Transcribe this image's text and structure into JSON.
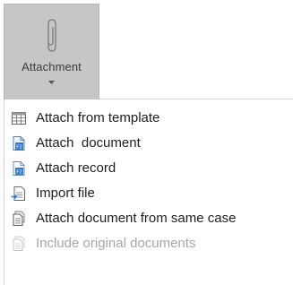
{
  "ribbon": {
    "attachment_button": {
      "label": "Attachment",
      "icon": "paperclip-icon",
      "state": "pressed"
    }
  },
  "menu": {
    "items": [
      {
        "label": "Attach from template",
        "icon": "template-grid-icon",
        "enabled": true
      },
      {
        "label": "Attach  document",
        "icon": "f2-document-icon",
        "enabled": true
      },
      {
        "label": "Attach record",
        "icon": "f2-record-icon",
        "enabled": true
      },
      {
        "label": "Import file",
        "icon": "import-file-icon",
        "enabled": true
      },
      {
        "label": "Attach document from same case",
        "icon": "case-document-icon",
        "enabled": true
      },
      {
        "label": "Include original documents",
        "icon": "original-documents-icon",
        "enabled": false
      }
    ]
  },
  "colors": {
    "button_pressed_bg": "#c6c6c6",
    "text": "#1e1e1e",
    "text_disabled": "#a6a6a6",
    "icon_blue": "#2f7bd1"
  }
}
